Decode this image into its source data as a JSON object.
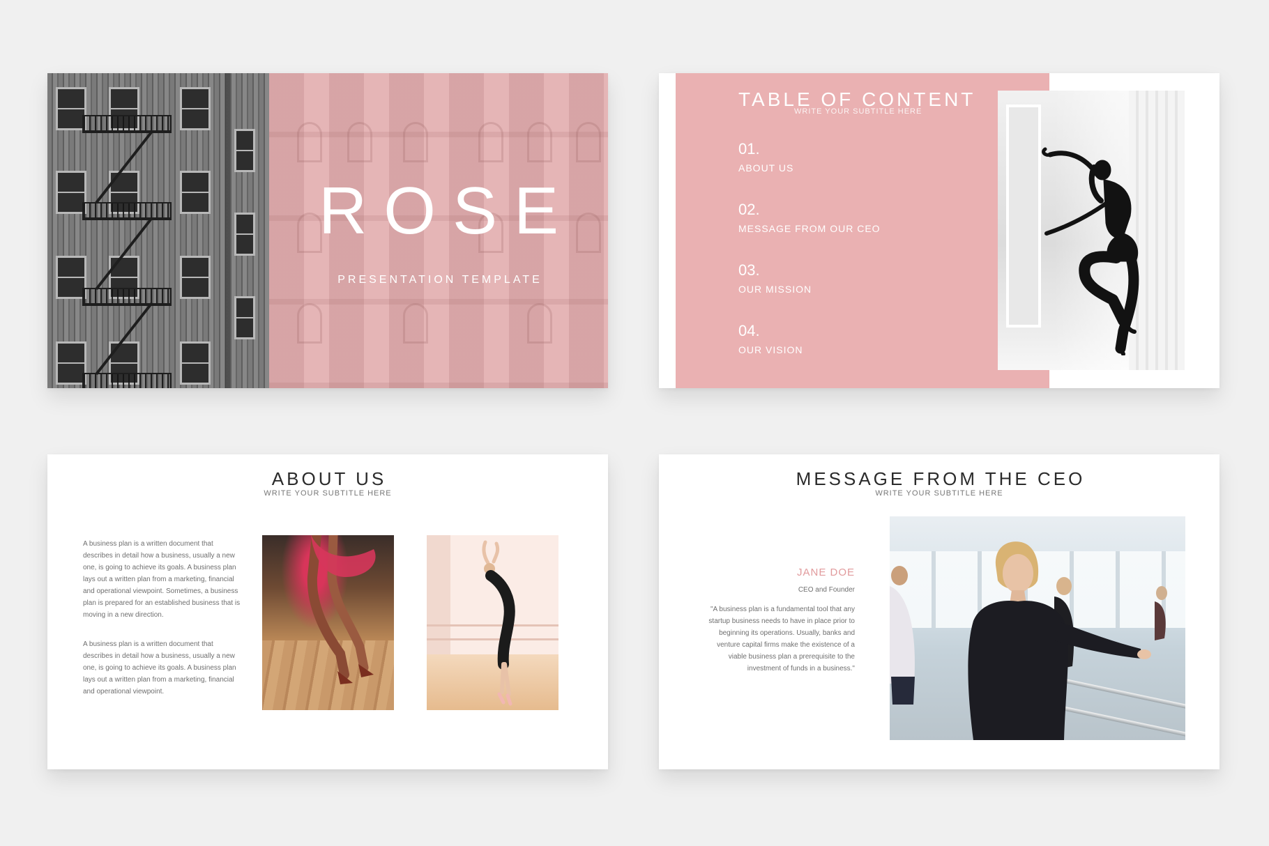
{
  "colors": {
    "background": "#f0f0f0",
    "rose": "#eab1b2",
    "rose_light": "#e5b5b6",
    "accent_text": "#e19a9c",
    "heading_text": "#2b2b2b",
    "body_text": "#6f6f6f"
  },
  "slide1": {
    "title": "ROSE",
    "subtitle": "PRESENTATION TEMPLATE"
  },
  "slide2": {
    "title": "TABLE OF CONTENT",
    "subtitle": "WRITE YOUR SUBTITLE HERE",
    "items": [
      {
        "number": "01.",
        "label": "ABOUT US"
      },
      {
        "number": "02.",
        "label": "MESSAGE FROM OUR CEO"
      },
      {
        "number": "03.",
        "label": "OUR MISSION"
      },
      {
        "number": "04.",
        "label": "OUR VISION"
      }
    ]
  },
  "slide3": {
    "title": "ABOUT US",
    "subtitle": "WRITE YOUR SUBTITLE HERE",
    "paragraph1": "A business plan is a written document that describes in detail how a business, usually a new one, is going to achieve its goals. A business plan lays out a written plan from a marketing, financial and operational viewpoint. Sometimes, a business plan is prepared for an established business that is moving in a new direction.",
    "paragraph2": "A business plan is a written document that describes in detail how a business, usually a new one, is going to achieve its goals. A business plan lays out a written plan from a marketing, financial and operational viewpoint."
  },
  "slide4": {
    "title": "MESSAGE FROM THE CEO",
    "subtitle": "WRITE YOUR SUBTITLE HERE",
    "name": "JANE DOE",
    "role": "CEO and Founder",
    "quote": "\"A business plan is a fundamental tool that any startup business needs to have in place prior to beginning its operations. Usually, banks and venture capital firms make the existence of a viable business plan a prerequisite to the investment of funds in a business.\""
  }
}
